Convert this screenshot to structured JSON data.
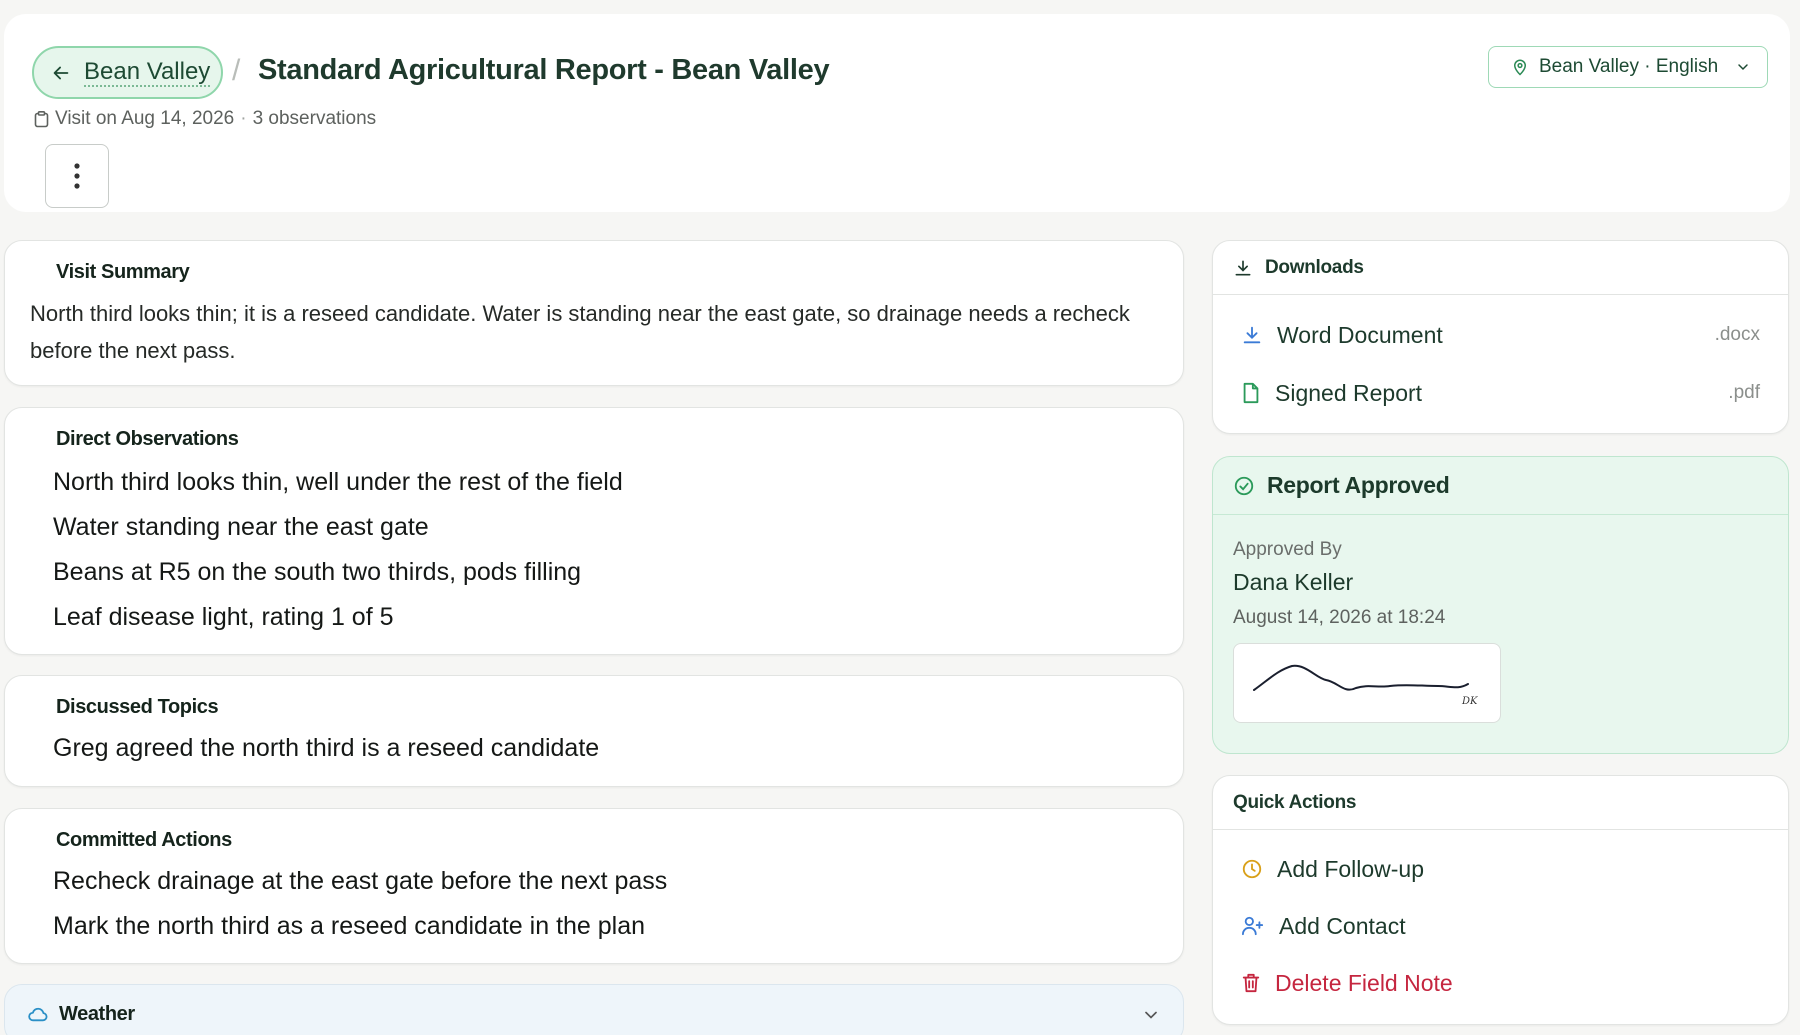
{
  "header": {
    "back_label": "Bean Valley",
    "separator": "/",
    "title": "Standard Agricultural Report - Bean Valley",
    "visit_date": "Visit on Aug 14, 2026",
    "meta_dot": "·",
    "observations_count": "3 observations",
    "locale": "Bean Valley · English"
  },
  "summary": {
    "title": "Visit Summary",
    "text": "North third looks thin; it is a reseed candidate. Water is standing near the east gate, so drainage needs a recheck before the next pass."
  },
  "observations": {
    "title": "Direct Observations",
    "items": [
      "North third looks thin, well under the rest of the field",
      "Water standing near the east gate",
      "Beans at R5 on the south two thirds, pods filling",
      "Leaf disease light, rating 1 of 5"
    ]
  },
  "topics": {
    "title": "Discussed Topics",
    "items": [
      "Greg agreed the north third is a reseed candidate"
    ]
  },
  "actions": {
    "title": "Committed Actions",
    "items": [
      "Recheck drainage at the east gate before the next pass",
      "Mark the north third as a reseed candidate in the plan"
    ]
  },
  "weather": {
    "title": "Weather"
  },
  "downloads": {
    "title": "Downloads",
    "items": [
      {
        "label": "Word Document",
        "ext": ".docx"
      },
      {
        "label": "Signed Report",
        "ext": ".pdf"
      }
    ]
  },
  "approval": {
    "title": "Report Approved",
    "by_label": "Approved By",
    "name": "Dana Keller",
    "date": "August 14, 2026 at 18:24",
    "signature_initials": "DK"
  },
  "quick_actions": {
    "title": "Quick Actions",
    "follow_up": "Add Follow-up",
    "contact": "Add Contact",
    "delete": "Delete Field Note"
  },
  "colors": {
    "accent_green": "#1d4a33",
    "approved_bg": "#e8f7ee",
    "delete_red": "#c5263f",
    "follow_up_amber": "#d9a019",
    "contact_blue": "#3b7bd6",
    "download_blue": "#3b7bd6"
  }
}
